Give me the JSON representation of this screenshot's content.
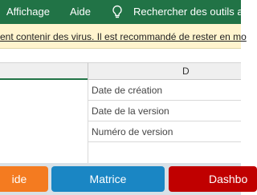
{
  "ribbon": {
    "tabs": [
      "Affichage",
      "Aide"
    ],
    "search_label": "Rechercher des outils ada",
    "search_icon": "lightbulb-icon",
    "background": "#217346"
  },
  "warning": {
    "text": "ent contenir des virus. Il est recommandé de rester en mo",
    "background": "#fff4ce"
  },
  "grid": {
    "column_header": "D",
    "rows": [
      "Date de création",
      "Date de la version",
      "Numéro de version"
    ]
  },
  "sheet_tabs": [
    {
      "label": "ide",
      "color": "#f47b20"
    },
    {
      "label": "Matrice",
      "color": "#1a86c4"
    },
    {
      "label": "Dashbo",
      "color": "#c00000"
    }
  ]
}
